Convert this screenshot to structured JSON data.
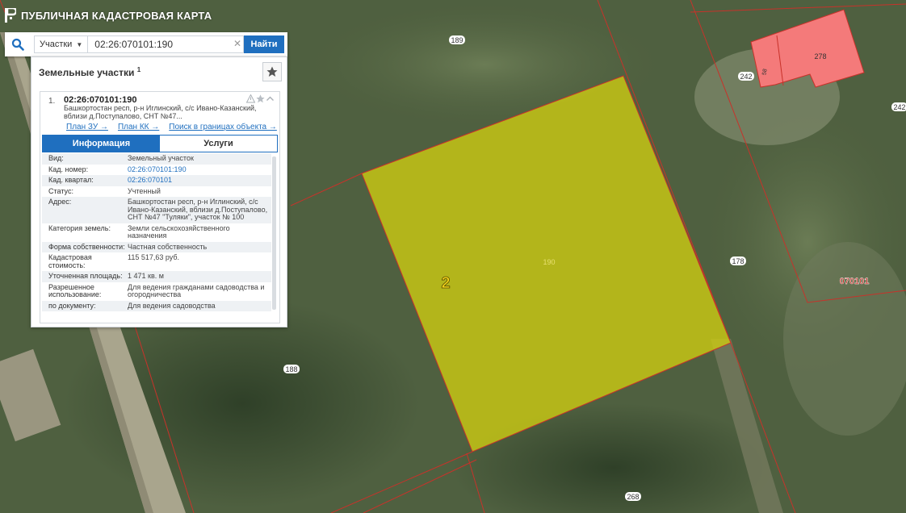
{
  "app": {
    "title": "ПУБЛИЧНАЯ КАДАСТРОВАЯ КАРТА"
  },
  "search": {
    "type_label": "Участки",
    "query": "02:26:070101:190",
    "find_label": "Найти"
  },
  "panel": {
    "title": "Земельные участки",
    "count_sup": "1",
    "result": {
      "index": "1.",
      "cad_number": "02:26:070101:190",
      "address_short": "Башкортостан респ, р-н Иглинский, с/с Ивано-Казанский, вблизи д.Поступалово, СНТ №47...",
      "links": [
        "План ЗУ →",
        "План КК →",
        "Поиск в границах объекта →"
      ]
    },
    "tabs": [
      "Информация",
      "Услуги"
    ],
    "rows": [
      {
        "k": "Вид:",
        "v": "Земельный участок"
      },
      {
        "k": "Кад. номер:",
        "v": "02:26:070101:190",
        "link": true
      },
      {
        "k": "Кад. квартал:",
        "v": "02:26:070101",
        "link": true
      },
      {
        "k": "Статус:",
        "v": "Учтенный"
      },
      {
        "k": "Адрес:",
        "v": "Башкортостан респ, р-н Иглинский, с/с Ивано-Казанский, вблизи д.Поступалово, СНТ №47 \"Туляки\", участок № 100"
      },
      {
        "k": "Категория земель:",
        "v": "Земли сельскохозяйственного назначения"
      },
      {
        "k": "Форма собственности:",
        "v": "Частная собственность"
      },
      {
        "k": "Кадастровая стоимость:",
        "v": "115 517,63 руб."
      },
      {
        "k": "Уточненная площадь:",
        "v": "1 471 кв. м"
      },
      {
        "k": "Разрешенное использование:",
        "v": "Для ведения гражданами садоводства и огородничества"
      },
      {
        "k": "по документу:",
        "v": "Для ведения садоводства"
      }
    ]
  },
  "map": {
    "parcel_labels": [
      "189",
      "190",
      "178",
      "188",
      "268",
      "242",
      "242",
      "278",
      "58",
      "070101"
    ],
    "annotation": "2",
    "colors": {
      "highlight": "#c9c814",
      "building": "#f47a7a",
      "boundary": "#c8322a"
    }
  }
}
